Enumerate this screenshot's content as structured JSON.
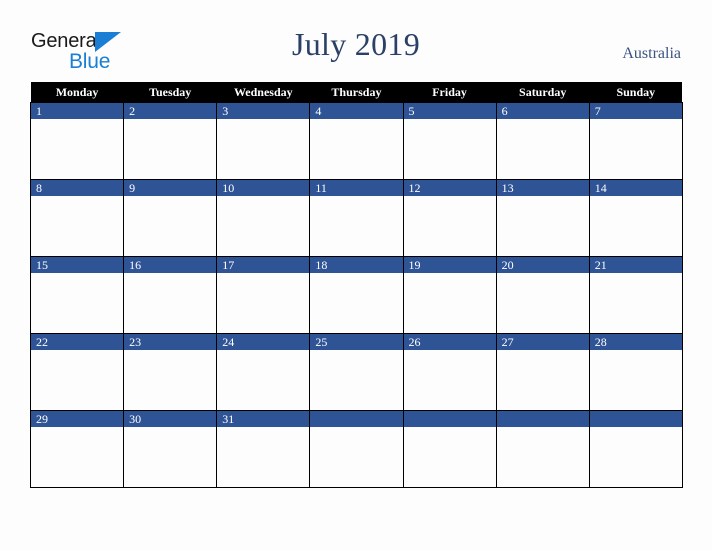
{
  "brand": {
    "name_top": "General",
    "name_bottom": "Blue",
    "triangle_color": "#1a7fd4",
    "top_color": "#1a1a1a"
  },
  "header": {
    "title": "July 2019",
    "country": "Australia",
    "title_color": "#2b4066"
  },
  "colors": {
    "header_row_bg": "#000000",
    "header_row_text": "#ffffff",
    "day_band_bg": "#2f5496",
    "day_band_text": "#ffffff",
    "cell_bg": "#fdfdfd",
    "grid_line": "#000000",
    "page_bg": "#fdfdfd"
  },
  "calendar": {
    "month": "July",
    "year": "2019",
    "weekday_headers": [
      "Monday",
      "Tuesday",
      "Wednesday",
      "Thursday",
      "Friday",
      "Saturday",
      "Sunday"
    ],
    "weeks": [
      {
        "days": [
          {
            "num": "1",
            "events": ""
          },
          {
            "num": "2",
            "events": ""
          },
          {
            "num": "3",
            "events": ""
          },
          {
            "num": "4",
            "events": ""
          },
          {
            "num": "5",
            "events": ""
          },
          {
            "num": "6",
            "events": ""
          },
          {
            "num": "7",
            "events": ""
          }
        ]
      },
      {
        "days": [
          {
            "num": "8",
            "events": ""
          },
          {
            "num": "9",
            "events": ""
          },
          {
            "num": "10",
            "events": ""
          },
          {
            "num": "11",
            "events": ""
          },
          {
            "num": "12",
            "events": ""
          },
          {
            "num": "13",
            "events": ""
          },
          {
            "num": "14",
            "events": ""
          }
        ]
      },
      {
        "days": [
          {
            "num": "15",
            "events": ""
          },
          {
            "num": "16",
            "events": ""
          },
          {
            "num": "17",
            "events": ""
          },
          {
            "num": "18",
            "events": ""
          },
          {
            "num": "19",
            "events": ""
          },
          {
            "num": "20",
            "events": ""
          },
          {
            "num": "21",
            "events": ""
          }
        ]
      },
      {
        "days": [
          {
            "num": "22",
            "events": ""
          },
          {
            "num": "23",
            "events": ""
          },
          {
            "num": "24",
            "events": ""
          },
          {
            "num": "25",
            "events": ""
          },
          {
            "num": "26",
            "events": ""
          },
          {
            "num": "27",
            "events": ""
          },
          {
            "num": "28",
            "events": ""
          }
        ]
      },
      {
        "days": [
          {
            "num": "29",
            "events": ""
          },
          {
            "num": "30",
            "events": ""
          },
          {
            "num": "31",
            "events": ""
          },
          {
            "num": "",
            "events": ""
          },
          {
            "num": "",
            "events": ""
          },
          {
            "num": "",
            "events": ""
          },
          {
            "num": "",
            "events": ""
          }
        ]
      }
    ]
  }
}
